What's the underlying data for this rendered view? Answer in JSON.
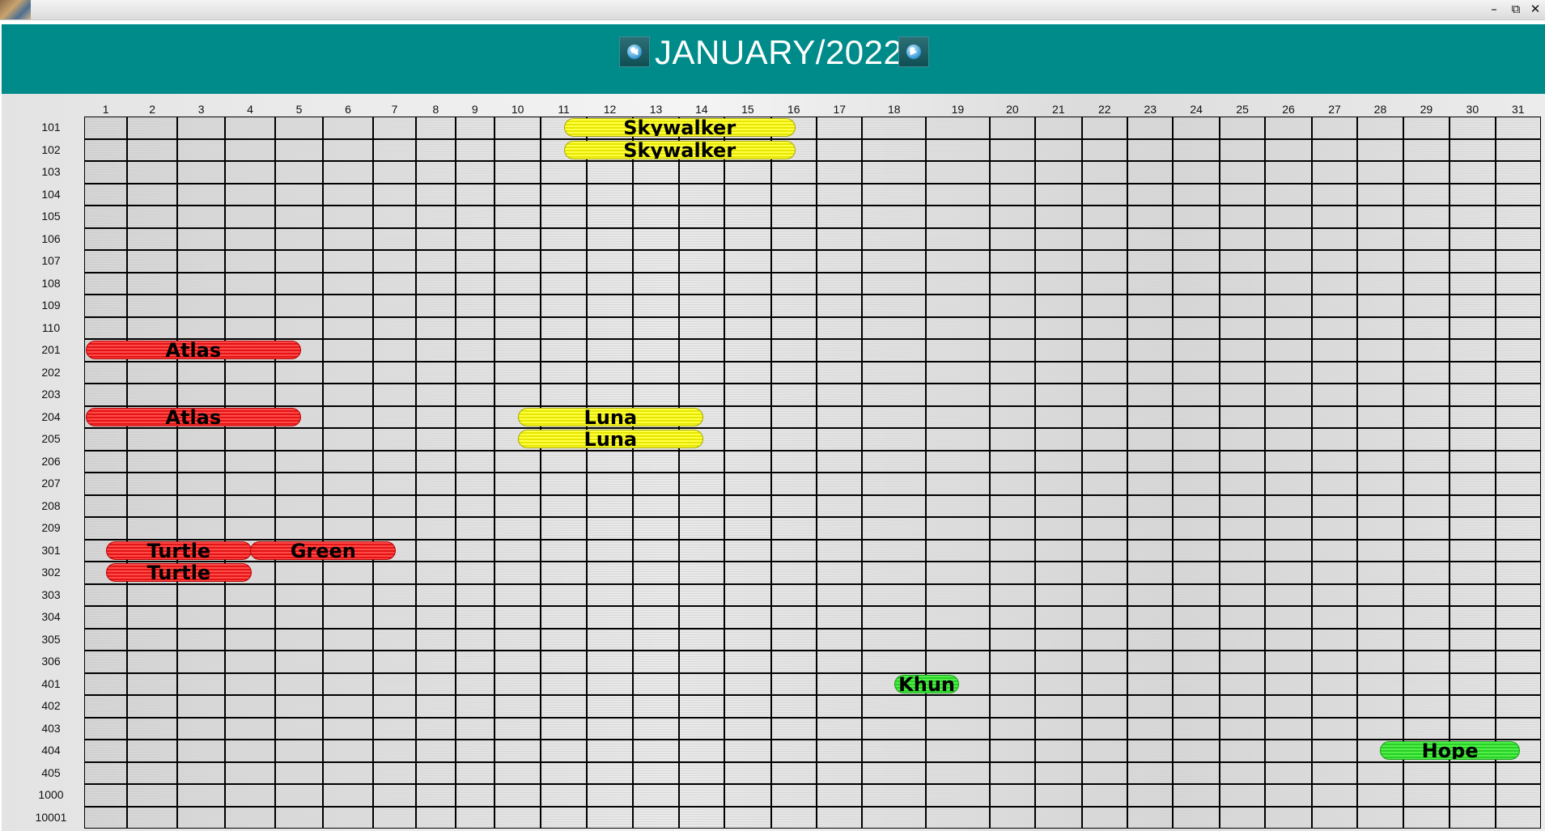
{
  "window": {
    "minimize_glyph": "–",
    "restore_glyph": "⧉",
    "close_glyph": "✕"
  },
  "header": {
    "title": "JANUARY/2022",
    "prev_glyph": "◀",
    "next_glyph": "▶",
    "background": "#008b8b"
  },
  "days": [
    "1",
    "2",
    "3",
    "4",
    "5",
    "6",
    "7",
    "8",
    "9",
    "10",
    "11",
    "12",
    "13",
    "14",
    "15",
    "16",
    "17",
    "18",
    "19",
    "20",
    "21",
    "22",
    "23",
    "24",
    "25",
    "26",
    "27",
    "28",
    "29",
    "30",
    "31"
  ],
  "rooms": [
    "101",
    "102",
    "103",
    "104",
    "105",
    "106",
    "107",
    "108",
    "109",
    "110",
    "201",
    "202",
    "203",
    "204",
    "205",
    "206",
    "207",
    "208",
    "209",
    "301",
    "302",
    "303",
    "304",
    "305",
    "306",
    "401",
    "402",
    "403",
    "404",
    "405",
    "1000",
    "10001"
  ],
  "bookings": [
    {
      "guest": "Skywalker",
      "room": "101",
      "from_day": 11,
      "to_day": 16,
      "color": "yellow"
    },
    {
      "guest": "Skywalker",
      "room": "102",
      "from_day": 11,
      "to_day": 16,
      "color": "yellow"
    },
    {
      "guest": "Atlas",
      "room": "201",
      "from_day": 1,
      "to_day": 5,
      "color": "red"
    },
    {
      "guest": "Atlas",
      "room": "204",
      "from_day": 1,
      "to_day": 5,
      "color": "red"
    },
    {
      "guest": "Luna",
      "room": "204",
      "from_day": 10,
      "to_day": 14,
      "color": "yellow"
    },
    {
      "guest": "Luna",
      "room": "205",
      "from_day": 10,
      "to_day": 14,
      "color": "yellow"
    },
    {
      "guest": "Turtle",
      "room": "301",
      "from_day": 1,
      "to_day": 4,
      "color": "red"
    },
    {
      "guest": "Green",
      "room": "301",
      "from_day": 4,
      "to_day": 7,
      "color": "red"
    },
    {
      "guest": "Turtle",
      "room": "302",
      "from_day": 1,
      "to_day": 4,
      "color": "red"
    },
    {
      "guest": "Khun",
      "room": "401",
      "from_day": 18,
      "to_day": 19,
      "color": "green"
    },
    {
      "guest": "Hope",
      "room": "404",
      "from_day": 28,
      "to_day": 31,
      "color": "green"
    }
  ]
}
